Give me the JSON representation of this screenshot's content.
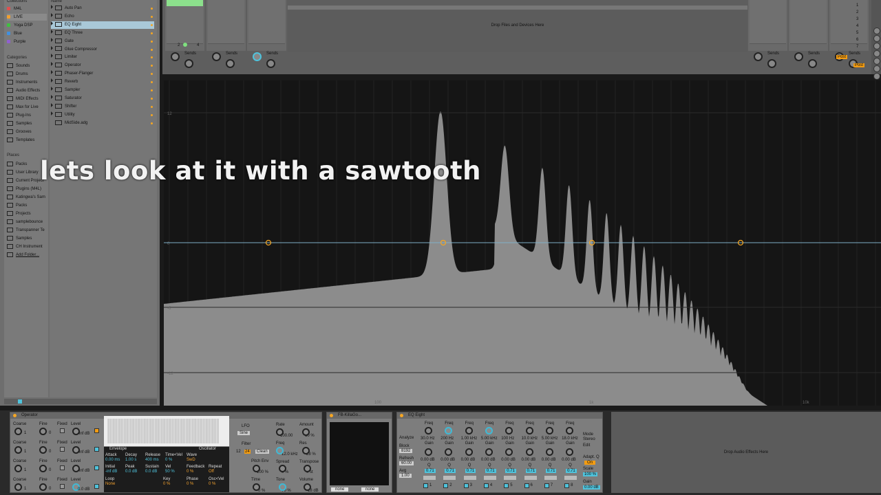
{
  "browser": {
    "collections_header": "Collections",
    "collections": [
      {
        "label": "M4L",
        "color": "#e05050"
      },
      {
        "label": "LIVE",
        "color": "#f0a030"
      },
      {
        "label": "Yoga DSP",
        "color": "#40c040"
      },
      {
        "label": "Blue",
        "color": "#4090e0"
      },
      {
        "label": "Purple",
        "color": "#9060d0"
      }
    ],
    "categories_header": "Categories",
    "categories": [
      "Sounds",
      "Drums",
      "Instruments",
      "Audio Effects",
      "MIDI Effects",
      "Max for Live",
      "Plug-Ins",
      "Samples",
      "Grooves",
      "Templates"
    ],
    "places_header": "Places",
    "places": [
      "Packs",
      "User Library",
      "Current Project",
      "Plugins (M4L)",
      "Katingwa's Sam",
      "Packs",
      "Projects",
      "samplebounce",
      "Transpanner Te",
      "Samples",
      "CH Instrument",
      "Add Folder..."
    ],
    "name_header": "Name",
    "files": [
      "Auto Pan",
      "Echo",
      "EQ Eight",
      "EQ Three",
      "Gate",
      "Glue Compressor",
      "Limiter",
      "Operator",
      "Phaser-Flanger",
      "Reverb",
      "Sampler",
      "Saturator",
      "Shifter",
      "Utility",
      "MidSide.adg"
    ],
    "selected_file": "EQ Eight"
  },
  "session": {
    "sends_label": "Sends",
    "drop_text": "Drop Files and Devices Here",
    "post_label": "Post",
    "scene_numbers": [
      "1",
      "2",
      "3",
      "4",
      "5",
      "6",
      "7"
    ],
    "clip_numbers": [
      "2",
      "4"
    ]
  },
  "eq_display": {
    "db_labels": [
      "12",
      "0",
      "-6",
      "-12"
    ],
    "freq_labels": [
      "100",
      "1k",
      "10k"
    ]
  },
  "overlay_caption": "lets look at it with a sawtooth",
  "operator": {
    "title": "Operator",
    "labels": {
      "coarse": "Coarse",
      "fine": "Fine",
      "fixed": "Fixed",
      "level": "Level"
    },
    "level_values": [
      "0.0 dB",
      "-inf dB",
      "-inf dB",
      "-inf dB"
    ],
    "coarse_values": [
      "1",
      "1",
      "1",
      "1"
    ],
    "fine_values": [
      "0",
      "0",
      "0",
      "0"
    ],
    "envelope_label": "Envelope",
    "oscillator_label": "Oscillator",
    "env_params": [
      {
        "label": "Attack",
        "value": "0.00 ms"
      },
      {
        "label": "Decay",
        "value": "1.00 s"
      },
      {
        "label": "Release",
        "value": "400 ms"
      },
      {
        "label": "Time<Vel",
        "value": "0 %"
      }
    ],
    "env_params2": [
      {
        "label": "Initial",
        "value": "-inf dB"
      },
      {
        "label": "Peak",
        "value": "0.0 dB"
      },
      {
        "label": "Sustain",
        "value": "0.0 dB"
      },
      {
        "label": "Vel",
        "value": "50 %"
      }
    ],
    "wave_label": "Wave",
    "wave_value": "SwD",
    "feedback_label": "Feedback",
    "feedback_value": "0 %",
    "repeat_label": "Repeat",
    "repeat_value": "Off",
    "loop_label": "Loop",
    "loop_value": "None",
    "key_label": "Key",
    "key_value": "0 %",
    "phase_label": "Phase",
    "phase_value": "0 %",
    "oscvel_label": "Osc<Vel",
    "oscvel_value": "0 %",
    "lfo_label": "LFO",
    "lfo_wave": "Sine",
    "rate_label": "Rate",
    "rate_value": "100.00",
    "amount_label": "Amount",
    "amount_value": "10 %",
    "filter_label": "Filter",
    "filter_type": "Clean",
    "filter_slopes": [
      "12",
      "24"
    ],
    "freq_label": "Freq",
    "freq_value": "12.0 kHz",
    "res_label": "Res",
    "res_value": "28 %",
    "pitchenv_label": "Pitch Env",
    "pitchenv_value": "100 %",
    "spread_label": "Spread",
    "spread_value": "0 %",
    "transpose_label": "Transpose",
    "transpose_value": "0 st",
    "time_label": "Time",
    "time_value": "0 %",
    "tone_label": "Tone",
    "tone_value": "70 %",
    "volume_label": "Volume",
    "volume_value": "-18 dB"
  },
  "killagon": {
    "title": "FB-KillaGo...",
    "selectors": [
      "none",
      "none"
    ]
  },
  "eq_eight": {
    "title": "EQ Eight",
    "analyze_label": "Analyze",
    "block_label": "Block",
    "block_value": "8192",
    "refresh_label": "Refresh",
    "refresh_value": "60.00",
    "avg_label": "Avg",
    "avg_value": "1.00",
    "mode_label": "Mode",
    "mode_value": "Stereo",
    "edit_label": "Edit",
    "adapt_label": "Adapt. Q",
    "on_label": "On",
    "scale_label": "Scale",
    "scale_value": "100 %",
    "gain_label": "Gain",
    "gain_value": "0.00 dB",
    "band_freq_label": "Freq",
    "band_gain_label": "Gain",
    "band_q_label": "Q",
    "bands": [
      {
        "n": "1",
        "freq": "30.0 Hz",
        "gain": "0.00 dB",
        "q": "0.71"
      },
      {
        "n": "2",
        "freq": "200 Hz",
        "gain": "0.00 dB",
        "q": "0.71"
      },
      {
        "n": "3",
        "freq": "1.00 kHz",
        "gain": "0.00 dB",
        "q": "0.71"
      },
      {
        "n": "4",
        "freq": "5.00 kHz",
        "gain": "0.00 dB",
        "q": "0.71"
      },
      {
        "n": "5",
        "freq": "100 Hz",
        "gain": "0.00 dB",
        "q": "0.71"
      },
      {
        "n": "6",
        "freq": "10.0 kHz",
        "gain": "0.00 dB",
        "q": "0.71"
      },
      {
        "n": "7",
        "freq": "5.00 kHz",
        "gain": "0.00 dB",
        "q": "0.71"
      },
      {
        "n": "8",
        "freq": "18.0 kHz",
        "gain": "0.00 dB",
        "q": "0.71"
      }
    ]
  },
  "drop_fx_text": "Drop Audio Effects Here",
  "colors": {
    "accent": "#f5a623",
    "knob_blue": "#4fc3dc",
    "eq_line": "#7fb0c8"
  }
}
